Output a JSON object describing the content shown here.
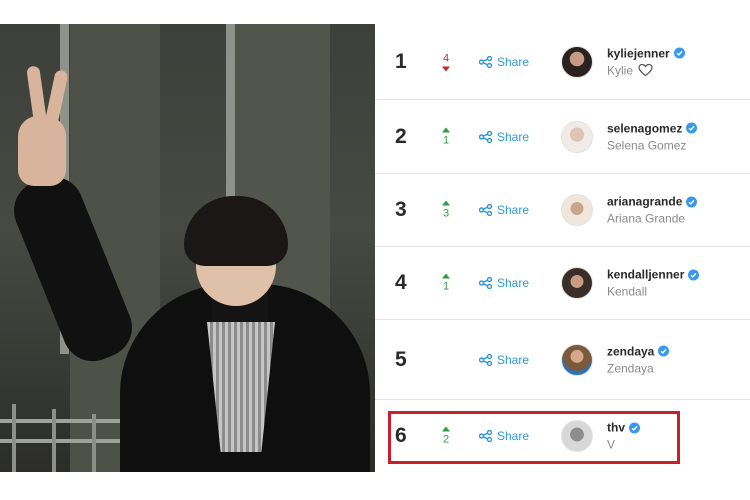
{
  "photo": {
    "subject": "person-giving-peace-sign"
  },
  "share_label": "Share",
  "colors": {
    "accent": "#2f97d9",
    "up": "#2e9e44",
    "down": "#c02a2a",
    "highlight": "#cc1f2b"
  },
  "ranking": [
    {
      "rank": "1",
      "change": "4",
      "direction": "down",
      "handle": "kyliejenner",
      "name": "Kylie",
      "heart": true
    },
    {
      "rank": "2",
      "change": "1",
      "direction": "up",
      "handle": "selenagomez",
      "name": "Selena Gomez",
      "heart": false
    },
    {
      "rank": "3",
      "change": "3",
      "direction": "up",
      "handle": "arianagrande",
      "name": "Ariana Grande",
      "heart": false
    },
    {
      "rank": "4",
      "change": "1",
      "direction": "up",
      "handle": "kendalljenner",
      "name": "Kendall",
      "heart": false
    },
    {
      "rank": "5",
      "change": "",
      "direction": "none",
      "handle": "zendaya",
      "name": "Zendaya",
      "heart": false
    },
    {
      "rank": "6",
      "change": "2",
      "direction": "up",
      "handle": "thv",
      "name": "V",
      "heart": false
    }
  ]
}
